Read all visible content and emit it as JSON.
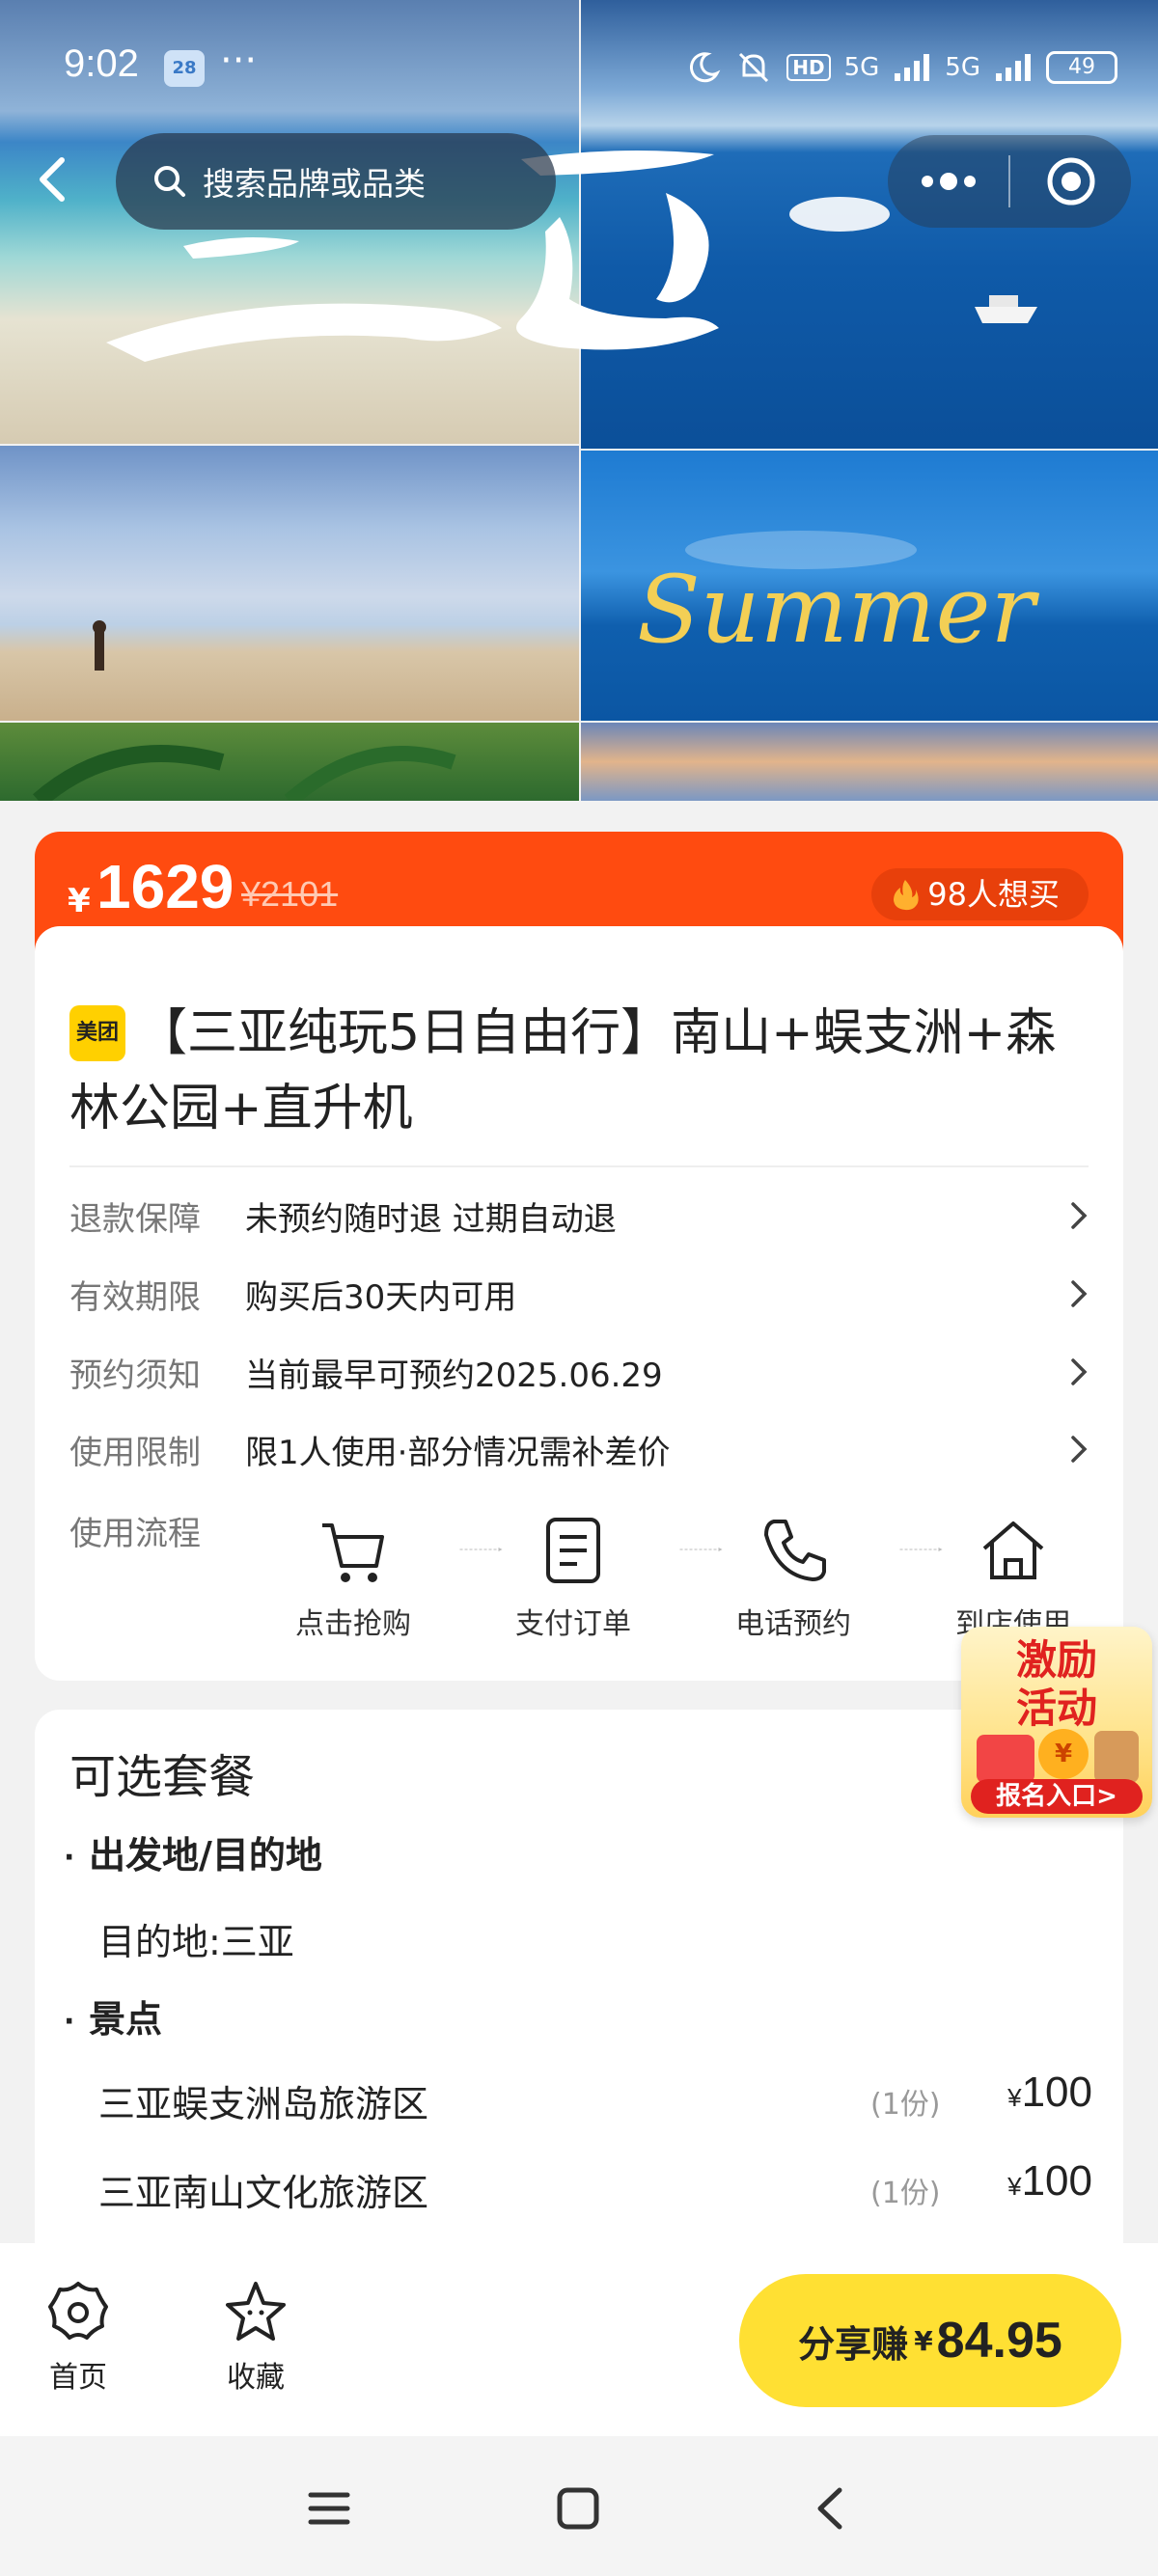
{
  "status_bar": {
    "time": "9:02",
    "calendar_badge": "28",
    "more_dots": "···",
    "hd_label": "HD",
    "network_1": "5G",
    "network_2": "5G",
    "battery": "49"
  },
  "header": {
    "search_placeholder": "搜索品牌或品类",
    "icons": [
      "back-arrow-icon",
      "search-icon",
      "more-dots-icon",
      "record-circle-icon"
    ]
  },
  "hero": {
    "calligraphy_text": "三亚",
    "script_text": "Summer"
  },
  "price_band": {
    "currency": "¥",
    "price": "1629",
    "original_price": "¥2101",
    "want_count": "98人想买",
    "fire_icon": "fire-icon"
  },
  "product": {
    "brand_badge": "美团",
    "title": "【三亚纯玩5日自由行】南山+蜈支洲+森林公园+直升机"
  },
  "info_rows": [
    {
      "label": "退款保障",
      "value": "未预约随时退 过期自动退"
    },
    {
      "label": "有效期限",
      "value": "购买后30天内可用"
    },
    {
      "label": "预约须知",
      "value": "当前最早可预约2025.06.29"
    },
    {
      "label": "使用限制",
      "value": "限1人使用·部分情况需补差价"
    }
  ],
  "flow": {
    "label": "使用流程",
    "steps": [
      {
        "label": "点击抢购",
        "icon": "cart-icon"
      },
      {
        "label": "支付订单",
        "icon": "document-icon"
      },
      {
        "label": "电话预约",
        "icon": "phone-icon"
      },
      {
        "label": "到店使用",
        "icon": "home-icon"
      }
    ]
  },
  "promo": {
    "line1": "激励",
    "line2": "活动",
    "coin": "¥",
    "button": "报名入口>"
  },
  "package": {
    "title": "可选套餐",
    "section1": "出发地/目的地",
    "destination": "目的地:三亚",
    "section2": "景点",
    "spots": [
      {
        "name": "三亚蜈支洲岛旅游区",
        "qty": "(1份)",
        "currency": "¥",
        "price": "100"
      },
      {
        "name": "三亚南山文化旅游区",
        "qty": "(1份)",
        "currency": "¥",
        "price": "100"
      }
    ]
  },
  "bottom_bar": {
    "home_label": "首页",
    "fav_label": "收藏",
    "share_label": "分享赚",
    "share_currency": "¥",
    "share_amount": "84.95"
  },
  "system_nav": [
    "menu-icon",
    "home-square-icon",
    "back-icon"
  ],
  "colors": {
    "accent_orange": "#ff4b10",
    "share_yellow": "#ffe033",
    "brand_yellow": "#ffd000"
  }
}
